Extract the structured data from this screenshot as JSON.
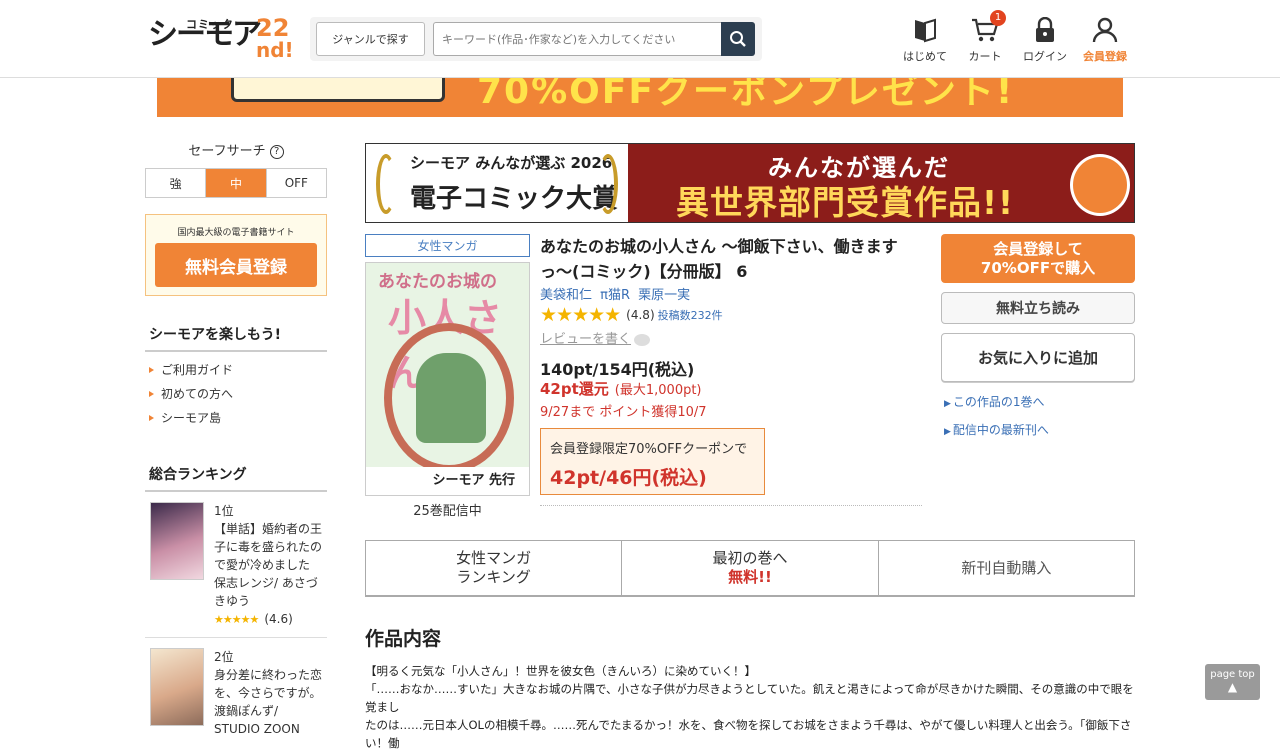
{
  "header": {
    "logo_kana": "シーモア",
    "logo_comic": "コミック",
    "logo_num": "22",
    "logo_nd": "nd!",
    "genre_button": "ジャンルで探す",
    "search_placeholder": "キーワード(作品･作家など)を入力してください",
    "nav": {
      "first": "はじめて",
      "cart": "カート",
      "cart_count": "1",
      "login": "ログイン",
      "register": "会員登録"
    }
  },
  "top_banner": {
    "text": "70%OFFクーポンプレゼント!"
  },
  "sidebar": {
    "safe_search_label": "セーフサーチ",
    "safe_options": [
      "強",
      "中",
      "OFF"
    ],
    "safe_selected": "中",
    "reg_small": "国内最大級の電子書籍サイト",
    "reg_button": "無料会員登録",
    "enjoy_heading": "シーモアを楽しもう!",
    "enjoy_links": [
      "ご利用ガイド",
      "初めての方へ",
      "シーモア島"
    ],
    "ranking_heading": "総合ランキング",
    "ranking": [
      {
        "rank": "1位",
        "title": "【単話】婚約者の王子に毒を盛られたので愛が冷めました",
        "author": "保志レンジ/ あさづきゆう",
        "stars": "★★★★★",
        "score": "(4.6)"
      },
      {
        "rank": "2位",
        "title": "身分差に終わった恋を、今さらですが。",
        "author": "渡鍋ぽんず/ STUDIO ZOON",
        "stars": "",
        "score": ""
      }
    ]
  },
  "award_banner": {
    "left_small": "シーモア みんなが選ぶ 2026",
    "left_big": "電子コミック大賞",
    "right_line1": "みんなが選んだ",
    "right_line2": "異世界部門受賞作品!!"
  },
  "product": {
    "category": "女性マンガ",
    "cover_title_small": "あなたのお城の",
    "cover_title_big": "小人さん",
    "cover_bottom": "シーモア 先行",
    "volume_count": "25巻配信中",
    "title": "あなたのお城の小人さん 〜御飯下さい、働きますっ〜(コミック)【分冊版】 6",
    "authors": "美袋和仁 π猫R 栗原一実",
    "rating_stars": "★★★★★",
    "rating_score": "(4.8)",
    "review_count": "投稿数232件",
    "review_link": "レビューを書く",
    "price": "140pt/154円(税込)",
    "cashback": "42pt還元",
    "cashback_max": "(最大1,000pt)",
    "period": "9/27まで ポイント獲得10/7",
    "coupon_label": "会員登録限定70%OFFクーポンで",
    "coupon_price": "42pt/46円(税込)"
  },
  "actions": {
    "buy_line1": "会員登録して",
    "buy_line2": "70%OFFで購入",
    "free_read": "無料立ち読み",
    "favorite": "お気に入りに追加",
    "link_vol1": "この作品の1巻へ",
    "link_latest": "配信中の最新刊へ"
  },
  "tabs": {
    "ranking_line1": "女性マンガ",
    "ranking_line2": "ランキング",
    "first_line1": "最初の巻へ",
    "first_line2": "無料!!",
    "auto_buy": "新刊自動購入"
  },
  "content": {
    "heading": "作品内容",
    "line1": "【明るく元気な「小人さん」！世界を彼女色（きんいろ）に染めていく！】",
    "line2": "「……おなか……すいた」大きなお城の片隅で、小さな子供が力尽きようとしていた。飢えと渇きによって命が尽きかけた瞬間、その意識の中で眼を覚まし",
    "line3": "たのは……元日本人OLの相模千尋。……死んでたまるかっ！水を、食べ物を探してお城をさまよう千尋は、やがて優しい料理人と出会う。「御飯下さい！働"
  },
  "page_top": "page top"
}
